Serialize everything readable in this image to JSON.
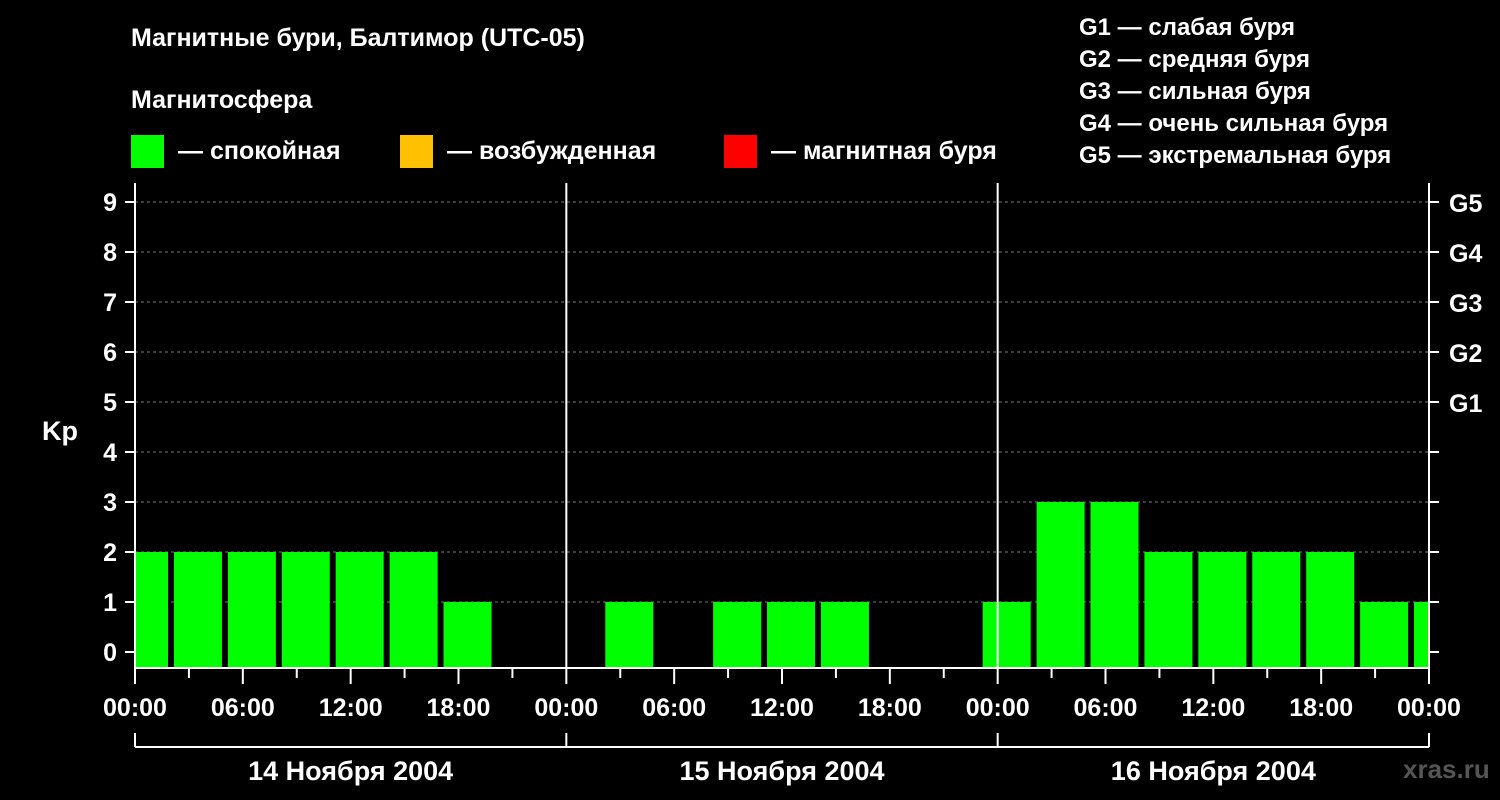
{
  "title": "Магнитные бури, Балтимор (UTC-05)",
  "magnetosphere_label": "Магнитосфера",
  "legend": [
    {
      "label": "— спокойная",
      "color": "#00ff00"
    },
    {
      "label": "— возбужденная",
      "color": "#ffc000"
    },
    {
      "label": "— магнитная буря",
      "color": "#ff0000"
    }
  ],
  "g_scale": [
    "G1 — слабая буря",
    "G2 — средняя буря",
    "G3 — сильная буря",
    "G4 — очень сильная буря",
    "G5 — экстремальная буря"
  ],
  "watermark": "xras.ru",
  "chart_data": {
    "type": "bar",
    "ylabel": "Kp",
    "ylim": [
      0,
      9
    ],
    "y_ticks": [
      "0",
      "1",
      "2",
      "3",
      "4",
      "5",
      "6",
      "7",
      "8",
      "9"
    ],
    "g_levels": [
      {
        "label": "G1",
        "kp": 5
      },
      {
        "label": "G2",
        "kp": 6
      },
      {
        "label": "G3",
        "kp": 7
      },
      {
        "label": "G4",
        "kp": 8
      },
      {
        "label": "G5",
        "kp": 9
      }
    ],
    "x_tick_labels": [
      "00:00",
      "06:00",
      "12:00",
      "18:00",
      "00:00",
      "06:00",
      "12:00",
      "18:00",
      "00:00",
      "06:00",
      "12:00",
      "18:00",
      "00:00"
    ],
    "days": [
      "14 Ноября 2004",
      "15 Ноября 2004",
      "16 Ноября 2004"
    ],
    "bar_color": "#00ff00",
    "grid": true,
    "bars": [
      {
        "hour": -1,
        "kp": 2
      },
      {
        "hour": 2,
        "kp": 2
      },
      {
        "hour": 5,
        "kp": 2
      },
      {
        "hour": 8,
        "kp": 2
      },
      {
        "hour": 11,
        "kp": 2
      },
      {
        "hour": 14,
        "kp": 2
      },
      {
        "hour": 17,
        "kp": 1
      },
      {
        "hour": 20,
        "kp": 0
      },
      {
        "hour": 23,
        "kp": 0
      },
      {
        "hour": 26,
        "kp": 1
      },
      {
        "hour": 29,
        "kp": 0
      },
      {
        "hour": 32,
        "kp": 1
      },
      {
        "hour": 35,
        "kp": 1
      },
      {
        "hour": 38,
        "kp": 1
      },
      {
        "hour": 41,
        "kp": 0
      },
      {
        "hour": 44,
        "kp": 0
      },
      {
        "hour": 47,
        "kp": 1
      },
      {
        "hour": 50,
        "kp": 3
      },
      {
        "hour": 53,
        "kp": 3
      },
      {
        "hour": 56,
        "kp": 2
      },
      {
        "hour": 59,
        "kp": 2
      },
      {
        "hour": 62,
        "kp": 2
      },
      {
        "hour": 65,
        "kp": 2
      },
      {
        "hour": 68,
        "kp": 1
      },
      {
        "hour": 71,
        "kp": 1
      }
    ]
  }
}
